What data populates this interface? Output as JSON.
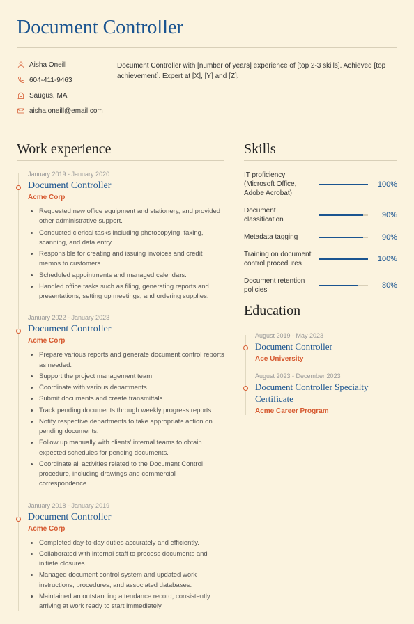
{
  "title": "Document Controller",
  "contact": {
    "name": "Aisha Oneill",
    "phone": "604-411-9463",
    "location": "Saugus, MA",
    "email": "aisha.oneill@email.com"
  },
  "summary": "Document Controller with [number of years] experience of [top 2-3 skills]. Achieved [top achievement]. Expert at [X], [Y] and [Z].",
  "sections": {
    "work": "Work experience",
    "skills": "Skills",
    "education": "Education"
  },
  "jobs": [
    {
      "dates": "January 2019 - January 2020",
      "title": "Document Controller",
      "company": "Acme Corp",
      "bullets": [
        "Requested new office equipment and stationery, and provided other administrative support.",
        "Conducted clerical tasks including photocopying, faxing, scanning, and data entry.",
        "Responsible for creating and issuing invoices and credit memos to customers.",
        "Scheduled appointments and managed calendars.",
        "Handled office tasks such as filing, generating reports and presentations, setting up meetings, and ordering supplies."
      ]
    },
    {
      "dates": "January 2022 - January 2023",
      "title": "Document Controller",
      "company": "Acme Corp",
      "bullets": [
        "Prepare various reports and generate document control reports as needed.",
        "Support the project management team.",
        "Coordinate with various departments.",
        "Submit documents and create transmittals.",
        "Track pending documents through weekly progress reports.",
        "Notify respective departments to take appropriate action on pending documents.",
        "Follow up manually with clients' internal teams to obtain expected schedules for pending documents.",
        "Coordinate all activities related to the Document Control procedure, including drawings and commercial correspondence."
      ]
    },
    {
      "dates": "January 2018 - January 2019",
      "title": "Document Controller",
      "company": "Acme Corp",
      "bullets": [
        "Completed day-to-day duties accurately and efficiently.",
        "Collaborated with internal staff to process documents and initiate closures.",
        "Managed document control system and updated work instructions, procedures, and associated databases.",
        "Maintained an outstanding attendance record, consistently arriving at work ready to start immediately."
      ]
    }
  ],
  "skills": [
    {
      "name": "IT proficiency (Microsoft Office, Adobe Acrobat)",
      "pct": "100%",
      "w": "100%"
    },
    {
      "name": "Document classification",
      "pct": "90%",
      "w": "90%"
    },
    {
      "name": "Metadata tagging",
      "pct": "90%",
      "w": "90%"
    },
    {
      "name": "Training on document control procedures",
      "pct": "100%",
      "w": "100%"
    },
    {
      "name": "Document retention policies",
      "pct": "80%",
      "w": "80%"
    }
  ],
  "education": [
    {
      "dates": "August 2019 - May 2023",
      "title": "Document Controller",
      "school": "Ace University"
    },
    {
      "dates": "August 2023 - December 2023",
      "title": "Document Controller Specialty Certificate",
      "school": "Acme Career Program"
    }
  ]
}
